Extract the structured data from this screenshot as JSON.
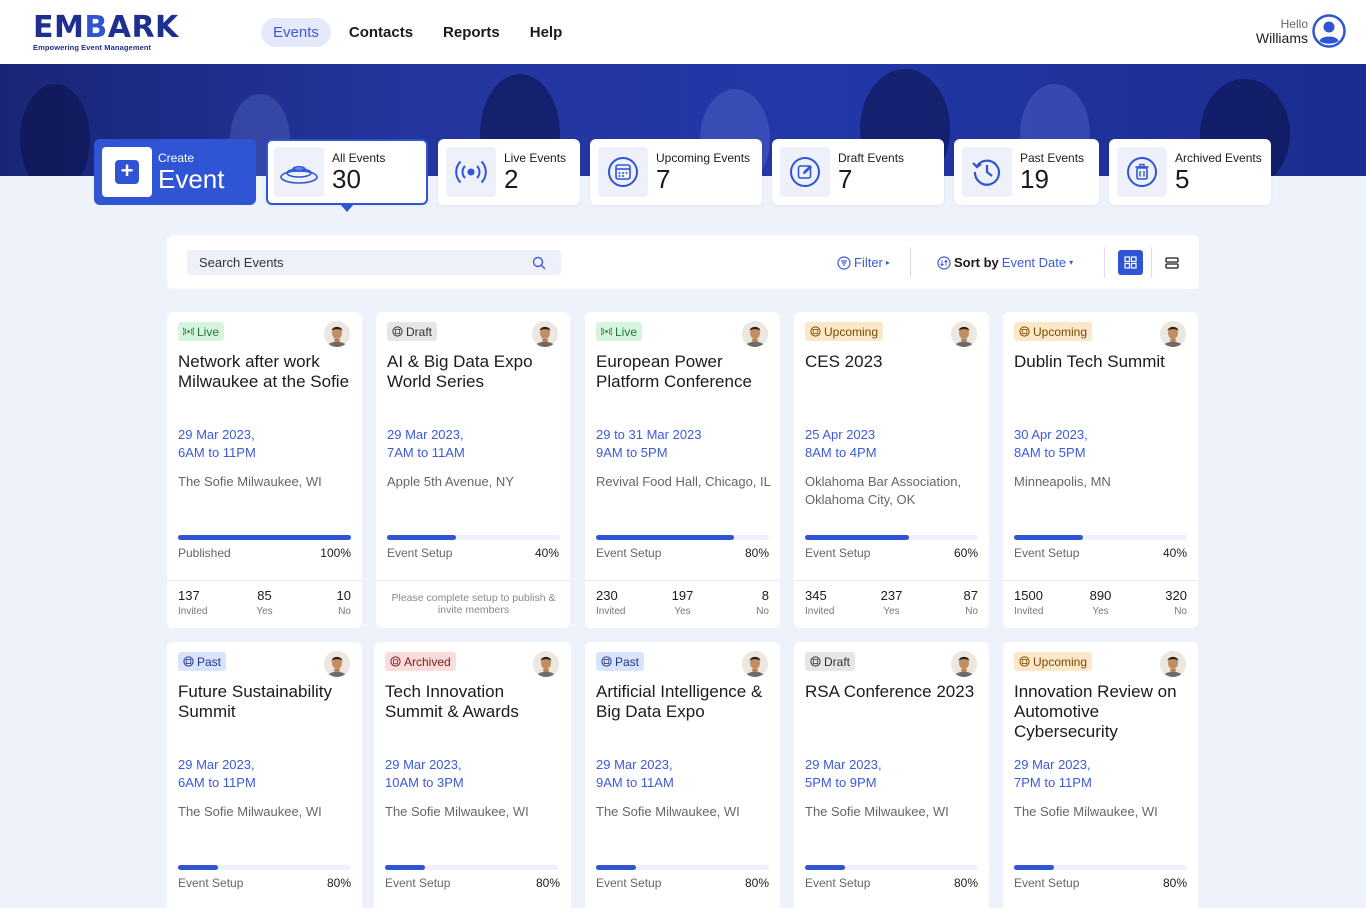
{
  "brand": {
    "name_part1": "EM",
    "name_part2": "B",
    "name_part3": "ARK",
    "tagline": "Empowering Event Management"
  },
  "nav": [
    {
      "label": "Events",
      "active": true
    },
    {
      "label": "Contacts",
      "active": false
    },
    {
      "label": "Reports",
      "active": false
    },
    {
      "label": "Help",
      "active": false
    }
  ],
  "user": {
    "greeting": "Hello",
    "name": "Williams"
  },
  "create": {
    "small": "Create",
    "big": "Event"
  },
  "stats": [
    {
      "label": "All Events",
      "count": "30",
      "icon": "all-events-icon"
    },
    {
      "label": "Live Events",
      "count": "2",
      "icon": "live-broadcast-icon"
    },
    {
      "label": "Upcoming Events",
      "count": "7",
      "icon": "calendar-icon"
    },
    {
      "label": "Draft Events",
      "count": "7",
      "icon": "edit-icon"
    },
    {
      "label": "Past Events",
      "count": "19",
      "icon": "history-icon"
    },
    {
      "label": "Archived Events",
      "count": "5",
      "icon": "trash-icon"
    }
  ],
  "toolbar": {
    "search_placeholder": "Search Events",
    "filter_label": "Filter",
    "sort_prefix": "Sort by",
    "sort_value": "Event Date"
  },
  "events": [
    {
      "status": "Live",
      "title": "Network after work Milwaukee at the Sofie",
      "date": "29 Mar 2023,",
      "time": "6AM to 11PM",
      "location": "The Sofie Milwaukee, WI",
      "progress_label": "Published",
      "progress": 100,
      "invited": "137",
      "yes": "85",
      "no": "10"
    },
    {
      "status": "Draft",
      "title": "AI & Big Data Expo World Series",
      "date": "29 Mar 2023,",
      "time": "7AM to 11AM",
      "location": "Apple 5th Avenue, NY",
      "progress_label": "Event Setup",
      "progress": 40,
      "note": "Please complete setup to publish & invite members"
    },
    {
      "status": "Live",
      "title": "European Power Platform Conference",
      "date": "29 to 31 Mar 2023",
      "time": "9AM to 5PM",
      "location": "Revival Food Hall, Chicago, IL",
      "progress_label": "Event Setup",
      "progress": 80,
      "invited": "230",
      "yes": "197",
      "no": "8"
    },
    {
      "status": "Upcoming",
      "title": "CES 2023",
      "date": "25 Apr 2023",
      "time": "8AM to 4PM",
      "location": "Oklahoma Bar Association, Oklahoma City, OK",
      "progress_label": "Event Setup",
      "progress": 60,
      "invited": "345",
      "yes": "237",
      "no": "87"
    },
    {
      "status": "Upcoming",
      "title": "Dublin Tech Summit",
      "date": "30 Apr 2023,",
      "time": "8AM to 5PM",
      "location": "Minneapolis, MN",
      "progress_label": "Event Setup",
      "progress": 40,
      "invited": "1500",
      "yes": "890",
      "no": "320"
    },
    {
      "status": "Past",
      "title": "Future Sustainability Summit",
      "date": "29 Mar 2023,",
      "time": "6AM to 11PM",
      "location": "The Sofie Milwaukee, WI",
      "progress_label": "Event Setup",
      "progress": 80
    },
    {
      "status": "Archived",
      "title": "Tech Innovation Summit & Awards",
      "date": "29 Mar 2023,",
      "time": "10AM to 3PM",
      "location": "The Sofie Milwaukee, WI",
      "progress_label": "Event Setup",
      "progress": 80
    },
    {
      "status": "Past",
      "title": "Artificial Intelligence & Big Data Expo",
      "date": "29 Mar 2023,",
      "time": "9AM to 11AM",
      "location": "The Sofie Milwaukee, WI",
      "progress_label": "Event Setup",
      "progress": 80
    },
    {
      "status": "Draft",
      "title": "RSA Conference 2023",
      "date": "29 Mar 2023,",
      "time": "5PM to 9PM",
      "location": "The Sofie Milwaukee, WI",
      "progress_label": "Event Setup",
      "progress": 80
    },
    {
      "status": "Upcoming",
      "title": "Innovation Review on Automotive Cybersecurity",
      "date": "29 Mar 2023,",
      "time": "7PM to 11PM",
      "location": "The Sofie Milwaukee, WI",
      "progress_label": "Event Setup",
      "progress": 80
    }
  ],
  "labels": {
    "invited": "Invited",
    "yes": "Yes",
    "no": "No"
  },
  "colors": {
    "primary": "#2f55d4",
    "navy": "#1e2f8f",
    "page_bg": "#eef2fb"
  }
}
